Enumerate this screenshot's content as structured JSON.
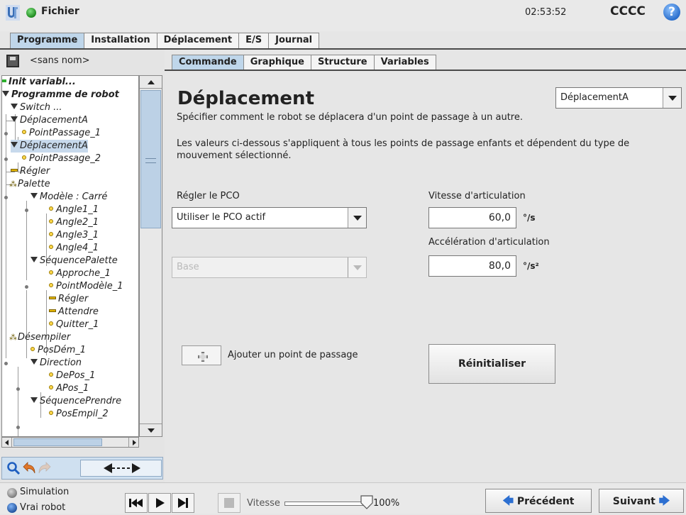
{
  "header": {
    "file_menu": "Fichier",
    "clock": "02:53:52",
    "robot_name": "CCCC",
    "help": "?"
  },
  "main_tabs": [
    "Programme",
    "Installation",
    "Déplacement",
    "E/S",
    "Journal"
  ],
  "left_panel": {
    "program_name": "<sans nom>",
    "tree": [
      {
        "label": "Init variabl...",
        "kind": "init"
      },
      {
        "label": "Programme de robot",
        "kind": "tri"
      },
      {
        "label": "Switch ...",
        "kind": "tri"
      },
      {
        "label": "DéplacementA",
        "kind": "tri"
      },
      {
        "label": "PointPassage_1",
        "kind": "dot"
      },
      {
        "label": "DéplacementA",
        "kind": "tri",
        "selected": true
      },
      {
        "label": "PointPassage_2",
        "kind": "dot"
      },
      {
        "label": "Régler",
        "kind": "dash"
      },
      {
        "label": "Palette",
        "kind": "pal"
      },
      {
        "label": "Modèle : Carré",
        "kind": "tri"
      },
      {
        "label": "Angle1_1",
        "kind": "dot"
      },
      {
        "label": "Angle2_1",
        "kind": "dot"
      },
      {
        "label": "Angle3_1",
        "kind": "dot"
      },
      {
        "label": "Angle4_1",
        "kind": "dot"
      },
      {
        "label": "SéquencePalette",
        "kind": "tri"
      },
      {
        "label": "Approche_1",
        "kind": "dot"
      },
      {
        "label": "PointModèle_1",
        "kind": "dot"
      },
      {
        "label": "Régler",
        "kind": "dash"
      },
      {
        "label": "Attendre",
        "kind": "dash"
      },
      {
        "label": "Quitter_1",
        "kind": "dot"
      },
      {
        "label": "Désempiler",
        "kind": "pal"
      },
      {
        "label": "PosDém_1",
        "kind": "dot"
      },
      {
        "label": "Direction",
        "kind": "tri"
      },
      {
        "label": "DePos_1",
        "kind": "dot"
      },
      {
        "label": "APos_1",
        "kind": "dot"
      },
      {
        "label": "SéquencePrendre",
        "kind": "tri"
      },
      {
        "label": "PosEmpil_2",
        "kind": "dot"
      }
    ]
  },
  "sub_tabs": [
    "Commande",
    "Graphique",
    "Structure",
    "Variables"
  ],
  "content": {
    "title": "Déplacement",
    "move_type_value": "DéplacementA",
    "description": "Spécifier comment le robot se déplacera d'un point de passage à un autre.",
    "note": "Les valeurs ci-dessous s'appliquent à tous les points de passage enfants et dépendent du type de mouvement sélectionné.",
    "tcp_label": "Régler le PCO",
    "tcp_value": "Utiliser le PCO actif",
    "feature_value": "Base",
    "joint_speed_label": "Vitesse d'articulation",
    "joint_speed_value": "60,0",
    "joint_speed_unit": "°/s",
    "joint_accel_label": "Accélération d'articulation",
    "joint_accel_value": "80,0",
    "joint_accel_unit": "°/s²",
    "add_waypoint_label": "Ajouter un point de passage",
    "reset_label": "Réinitialiser"
  },
  "footer": {
    "simulation_label": "Simulation",
    "real_robot_label": "Vrai robot",
    "speed_label": "Vitesse",
    "speed_value": "100%",
    "speed_fraction": 1.0,
    "prev_label": "Précédent",
    "next_label": "Suivant"
  }
}
